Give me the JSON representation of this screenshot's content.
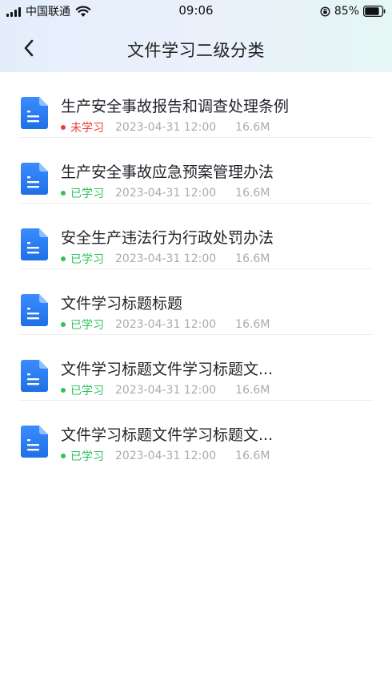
{
  "status_bar": {
    "carrier": "中国联通",
    "time": "09:06",
    "battery_percent": "85%",
    "battery_level": 0.85
  },
  "header": {
    "title": "文件学习二级分类",
    "back_icon": "chevron-left-icon"
  },
  "documents": [
    {
      "title": "生产安全事故报告和调查处理条例",
      "status": "未学习",
      "status_color": "#f03a3a",
      "date": "2023-04-31 12:00",
      "size": "16.6M"
    },
    {
      "title": "生产安全事故应急预案管理办法",
      "status": "已学习",
      "status_color": "#2fc35b",
      "date": "2023-04-31 12:00",
      "size": "16.6M"
    },
    {
      "title": "安全生产违法行为行政处罚办法",
      "status": "已学习",
      "status_color": "#2fc35b",
      "date": "2023-04-31 12:00",
      "size": "16.6M"
    },
    {
      "title": "文件学习标题标题",
      "status": "已学习",
      "status_color": "#2fc35b",
      "date": "2023-04-31 12:00",
      "size": "16.6M"
    },
    {
      "title": "文件学习标题文件学习标题文...",
      "status": "已学习",
      "status_color": "#2fc35b",
      "date": "2023-04-31 12:00",
      "size": "16.6M"
    },
    {
      "title": "文件学习标题文件学习标题文...",
      "status": "已学习",
      "status_color": "#2fc35b",
      "date": "2023-04-31 12:00",
      "size": "16.6M"
    }
  ],
  "colors": {
    "doc_icon": "#2f7cf6",
    "meta_text": "#a8abb0"
  }
}
